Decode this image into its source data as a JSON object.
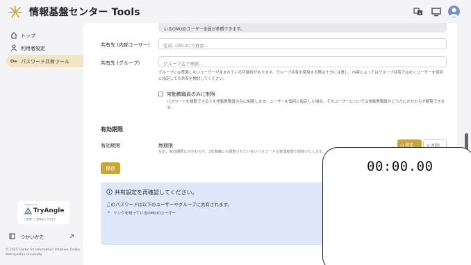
{
  "header": {
    "title": "情報基盤センター Tools",
    "icons": [
      "translate-icon",
      "display-icon",
      "user-avatar-icon"
    ]
  },
  "sidebar": {
    "items": [
      {
        "label": "トップ",
        "icon": "home-icon"
      },
      {
        "label": "利用者設定",
        "icon": "user-icon"
      },
      {
        "label": "パスワード共有ツール",
        "icon": "key-icon",
        "active": true
      }
    ],
    "tryangle": {
      "powered_by": "Powered by",
      "brand": "TryAngle",
      "sub": "ご質問・ご意見はこちらまで"
    },
    "howto_label": "つかいかた",
    "copyright": "© 2025 Center for Information Initiative, Osaka Metropolitan University."
  },
  "form": {
    "notice_text": "いるOMUIDユーザー全員が参照できます。",
    "share_user_label": "共有先 (内部ユーザー)",
    "share_user_placeholder": "名前, OMUIDで検索...",
    "share_group_label": "共有先 (グループ)",
    "share_group_placeholder": "グループ名で検索...",
    "group_help": "グループには意図しないユーザーが含まれている可能性があります。グループ共有を使用する際は十分に注意し、内容によってはグループ共有ではなくユーザーを個別に指定しての共有を検討してください。",
    "fulltime_label": "常勤教職員のみに制限",
    "fulltime_help": "パスワードを閲覧できる人を常勤教職員のみに制限します。ユーザーを個別に指定した場合、そのユーザーについては常勤教職員かどうかにかかわらず閲覧できます。",
    "expiry_section": "有効期限",
    "expiry_label": "有効期限",
    "expiry_value": "無期限",
    "expiry_desc": "なお、有効期限にかかわらず、2年間誰にも閲覧されていないパスワードは管理者側で削除いたします。",
    "set_button": "設定",
    "delete_button": "削除",
    "save_button": "保存"
  },
  "confirm": {
    "title": "共有設定を再確認してください。",
    "desc": "このパスワードは以下のユーザーやグループに共有されます。",
    "items": [
      "リンクを知っているOMUIDユーザー"
    ]
  },
  "timer": {
    "value": "00:00.00"
  },
  "colors": {
    "accent": "#c9a43a",
    "active_nav": "#f1e6c4",
    "confirm_bg": "#dfe7fb"
  }
}
